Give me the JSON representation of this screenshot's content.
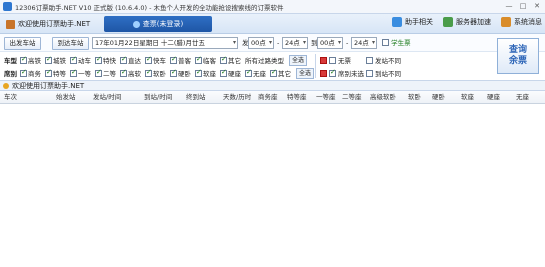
{
  "window": {
    "title": "12306订票助手.NET V10 正式版 (10.6.4.0) - 木鱼个人开发的全功能抢设搜索线的订票软件",
    "min": "—",
    "max": "□",
    "close": "✕"
  },
  "toolbar": {
    "home_tab": "欢迎使用订票助手.NET",
    "login_tab": "查票(未登录)",
    "right_items": [
      {
        "label": "助手相关",
        "icon": "help-icon",
        "color": "#3a8de0"
      },
      {
        "label": "服务器加速",
        "icon": "server-icon",
        "color": "#4a9c4a"
      },
      {
        "label": "系统消息",
        "icon": "message-icon",
        "color": "#d98c2a"
      }
    ]
  },
  "query": {
    "from_btn": "出发车站",
    "to_btn": "到达车站",
    "date": "17年01月22日星期日 十二(腊)月廿五",
    "depart_label": "发",
    "time_from": "00点",
    "time_to": "24点",
    "arrive_label": "到",
    "arr_from": "00点",
    "arr_to": "24点",
    "student": "学生票",
    "search_line1": "查询",
    "search_line2": "余票"
  },
  "filters": {
    "row1_label": "车型",
    "row1": [
      "高铁",
      "城铁",
      "动车",
      "特快",
      "直达",
      "快车",
      "普客",
      "临客",
      "其它"
    ],
    "row1_extra": "所有过路类型",
    "row1_all": "全选",
    "row2_label": "席别",
    "row2": [
      "商务",
      "特等",
      "一等",
      "二等",
      "高软",
      "软卧",
      "硬卧",
      "软座",
      "硬座",
      "无座",
      "其它"
    ],
    "row2_all": "全选",
    "right_col1": [
      "无票",
      "席别未选"
    ],
    "right_col2": [
      "发站不同",
      "到站不同"
    ]
  },
  "notice": "欢迎使用订票助手.NET",
  "grid": {
    "columns": [
      "车次",
      "始发站",
      "发站/时间",
      "到站/时间",
      "终到站",
      "天数/历时",
      "商务座",
      "特等座",
      "一等座",
      "二等座",
      "高级软卧",
      "软卧",
      "硬卧",
      "软座",
      "硬座",
      "无座"
    ]
  },
  "colors": {
    "accent": "#2e66b8",
    "login_tab": "#2f6fc4"
  }
}
